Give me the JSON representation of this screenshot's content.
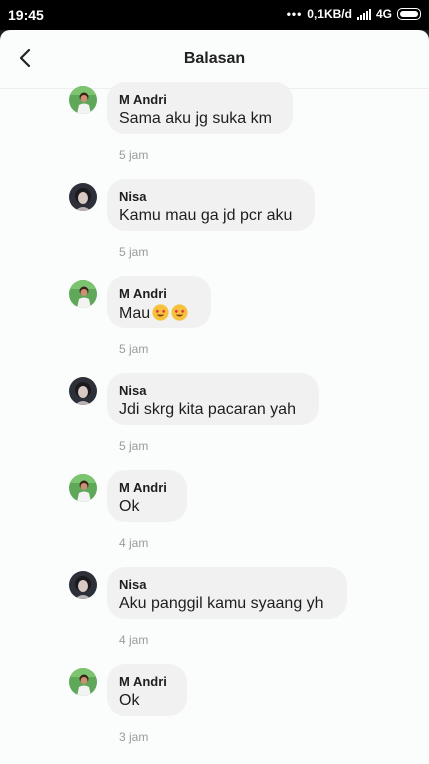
{
  "status": {
    "time": "19:45",
    "speed": "0,1KB/d",
    "network": "4G"
  },
  "header": {
    "title": "Balasan"
  },
  "messages": [
    {
      "sender": "M Andri",
      "text": "Sama aku jg suka km",
      "time": "5 jam",
      "avatar": "green"
    },
    {
      "sender": "Nisa",
      "text": "Kamu mau ga jd pcr aku",
      "time": "5 jam",
      "avatar": "dark"
    },
    {
      "sender": "M Andri",
      "text": "Mau",
      "time": "5 jam",
      "avatar": "green",
      "emoji": [
        "heart-eyes-emoji",
        "heart-eyes-emoji"
      ]
    },
    {
      "sender": "Nisa",
      "text": "Jdi skrg kita pacaran yah",
      "time": "5 jam",
      "avatar": "dark"
    },
    {
      "sender": "M Andri",
      "text": "Ok",
      "time": "4 jam",
      "avatar": "green"
    },
    {
      "sender": "Nisa",
      "text": "Aku panggil kamu syaang yh",
      "time": "4 jam",
      "avatar": "dark"
    },
    {
      "sender": "M Andri",
      "text": "Ok",
      "time": "3 jam",
      "avatar": "green"
    }
  ],
  "colors": {
    "bubble": "#f1f1f1",
    "sheet": "#fbfcfc",
    "avatar_green": "#5fa85a",
    "avatar_dark": "#2d3038"
  }
}
